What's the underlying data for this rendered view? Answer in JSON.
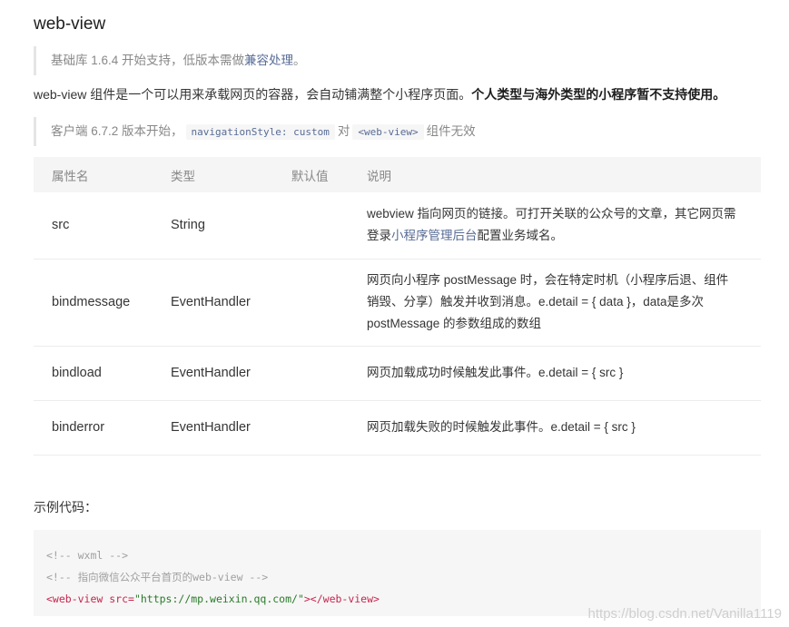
{
  "title": "web-view",
  "note1": {
    "prefix": "基础库 1.6.4 开始支持，低版本需做",
    "link": "兼容处理",
    "suffix": "。"
  },
  "description": {
    "text": "web-view 组件是一个可以用来承载网页的容器，会自动铺满整个小程序页面。",
    "bold": "个人类型与海外类型的小程序暂不支持使用。"
  },
  "note2": {
    "prefix": "客户端 6.7.2 版本开始，",
    "code1": "navigationStyle: custom",
    "mid": "对",
    "code2": "<web-view>",
    "suffix": "组件无效"
  },
  "table": {
    "headers": [
      "属性名",
      "类型",
      "默认值",
      "说明"
    ],
    "rows": [
      {
        "name": "src",
        "type": "String",
        "default": "",
        "desc_prefix": "webview 指向网页的链接。可打开关联的公众号的文章，其它网页需登录",
        "desc_link": "小程序管理后台",
        "desc_suffix": "配置业务域名。"
      },
      {
        "name": "bindmessage",
        "type": "EventHandler",
        "default": "",
        "desc_prefix": "网页向小程序 postMessage 时，会在特定时机（小程序后退、组件销毁、分享）触发并收到消息。e.detail = { data }，data是多次 postMessage 的参数组成的数组",
        "desc_link": "",
        "desc_suffix": ""
      },
      {
        "name": "bindload",
        "type": "EventHandler",
        "default": "",
        "desc_prefix": "网页加载成功时候触发此事件。e.detail = { src }",
        "desc_link": "",
        "desc_suffix": ""
      },
      {
        "name": "binderror",
        "type": "EventHandler",
        "default": "",
        "desc_prefix": "网页加载失败的时候触发此事件。e.detail = { src }",
        "desc_link": "",
        "desc_suffix": ""
      }
    ]
  },
  "sample_label": "示例代码：",
  "code": {
    "line1": "<!-- wxml -->",
    "line2": "<!-- 指向微信公众平台首页的web-view -->",
    "line3_open": "<web-view",
    "line3_attr": " src=",
    "line3_value": "\"https://mp.weixin.qq.com/\"",
    "line3_close": "></web-view>"
  },
  "watermark": "https://blog.csdn.net/Vanilla1119"
}
